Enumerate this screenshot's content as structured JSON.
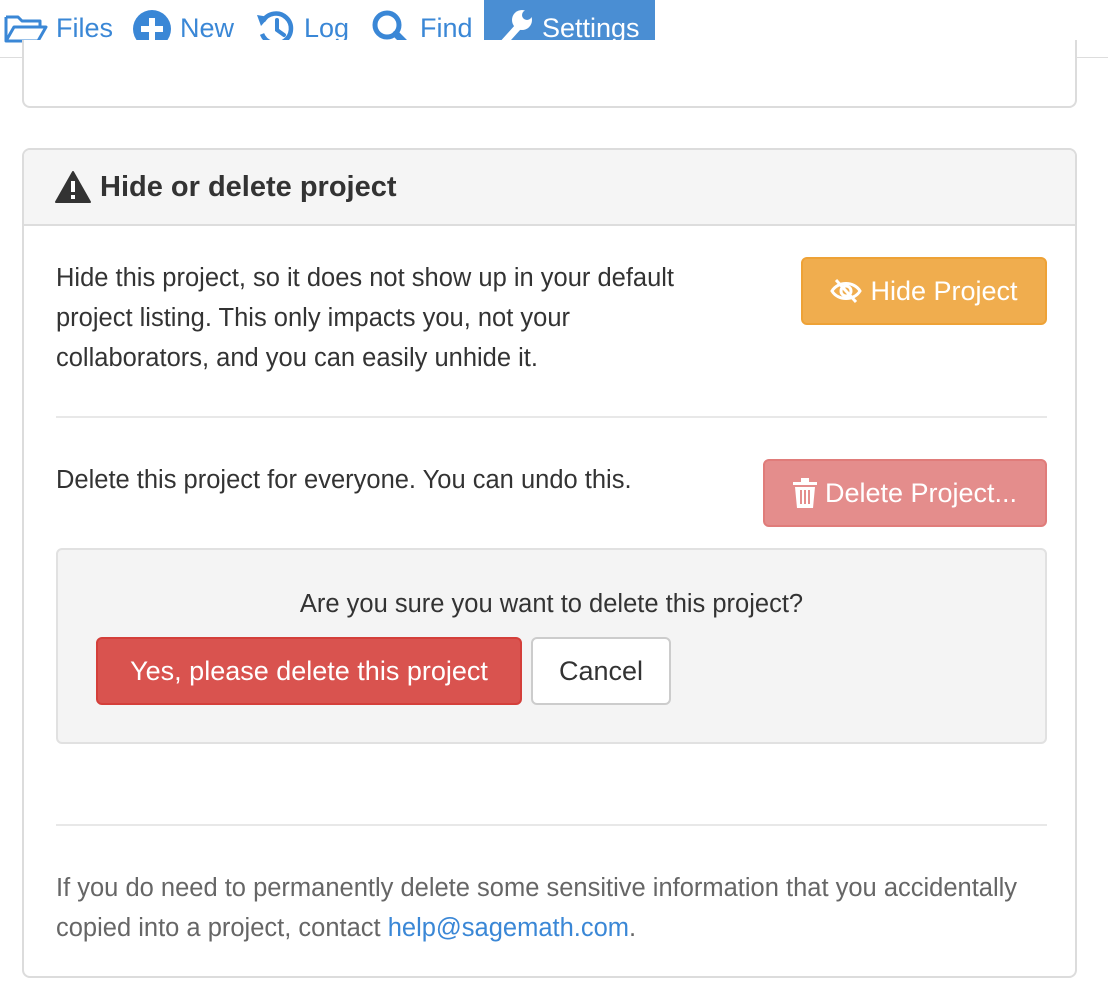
{
  "nav": {
    "tabs": [
      {
        "label": "Files",
        "icon": "folder-open-icon"
      },
      {
        "label": "New",
        "icon": "plus-circle-icon"
      },
      {
        "label": "Log",
        "icon": "history-icon"
      },
      {
        "label": "Find",
        "icon": "search-icon"
      },
      {
        "label": "Settings",
        "icon": "wrench-icon",
        "active": true
      }
    ],
    "accent_color": "#4a8ed3"
  },
  "panel": {
    "title": "Hide or delete project",
    "title_icon": "warning-icon",
    "hide": {
      "description": "Hide this project, so it does not show up in your default project listing. This only impacts you, not your collaborators, and you can easily unhide it.",
      "button_label": "Hide Project",
      "button_icon": "eye-slash-icon",
      "button_color": "#f0ad4e"
    },
    "delete": {
      "description": "Delete this project for everyone. You can undo this.",
      "button_label": "Delete Project...",
      "button_icon": "trash-icon",
      "button_color": "#e48d8c"
    },
    "confirm": {
      "question": "Are you sure you want to delete this project?",
      "yes_label": "Yes, please delete this project",
      "cancel_label": "Cancel",
      "yes_color": "#d9534f"
    },
    "footer": {
      "text_before": "If you do need to permanently delete some sensitive information that you accidentally copied into a project, contact ",
      "link_text": "help@sagemath.com",
      "text_after": "."
    }
  }
}
